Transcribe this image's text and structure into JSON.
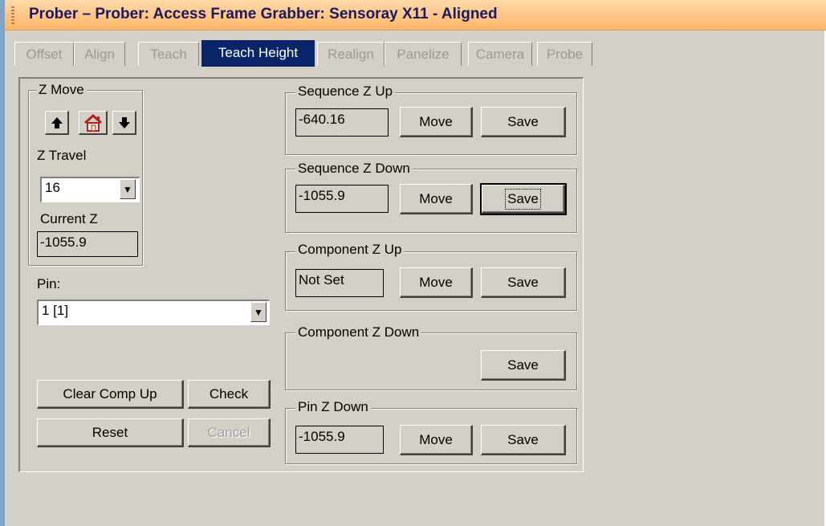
{
  "window": {
    "title": "Prober – Prober: Access Frame Grabber: Sensoray X11 - Aligned"
  },
  "tabs": [
    {
      "label": "Offset"
    },
    {
      "label": "Align"
    },
    {
      "label": "Teach"
    },
    {
      "label": "Teach Height"
    },
    {
      "label": "Realign"
    },
    {
      "label": "Panelize"
    },
    {
      "label": "Camera"
    },
    {
      "label": "Probe"
    }
  ],
  "active_tab": "Teach Height",
  "z_move": {
    "title": "Z Move",
    "z_travel_label": "Z Travel",
    "z_travel_value": "16",
    "current_z_label": "Current Z",
    "current_z_value": "-1055.9",
    "icons": [
      "arrow-up-icon",
      "home-icon",
      "arrow-down-icon"
    ]
  },
  "pin": {
    "label": "Pin:",
    "value": "1 [1]"
  },
  "buttons": {
    "clear_comp_up": "Clear Comp Up",
    "check": "Check",
    "reset": "Reset",
    "cancel": "Cancel"
  },
  "groups": {
    "seq_z_up": {
      "title": "Sequence Z Up",
      "value": "-640.16",
      "move": "Move",
      "save": "Save"
    },
    "seq_z_down": {
      "title": "Sequence Z Down",
      "value": "-1055.9",
      "move": "Move",
      "save": "Save"
    },
    "comp_z_up": {
      "title": "Component Z Up",
      "value": "Not Set",
      "move": "Move",
      "save": "Save"
    },
    "comp_z_down": {
      "title": "Component Z Down",
      "save": "Save"
    },
    "pin_z_down": {
      "title": "Pin Z Down",
      "value": "-1055.9",
      "move": "Move",
      "save": "Save"
    }
  },
  "colors": {
    "title_bar": "#fcb66a",
    "title_text": "#1b1a5e",
    "active_tab": "#0a246a",
    "face": "#d4d0c8"
  }
}
